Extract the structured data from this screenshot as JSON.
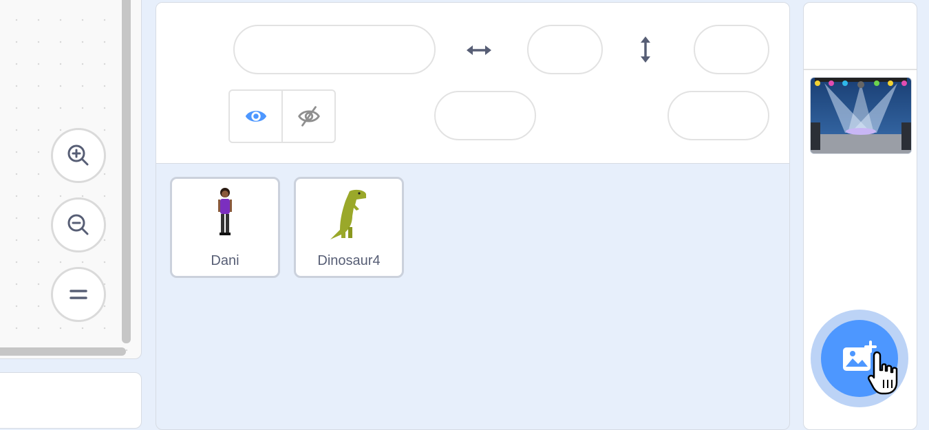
{
  "code_area": {
    "zoom_in_icon": "zoom-in-icon",
    "zoom_out_icon": "zoom-out-icon",
    "zoom_reset_icon": "equals-icon"
  },
  "sprite_info": {
    "sprite_name_value": "",
    "x_value": "",
    "y_value": "",
    "size_value": "",
    "direction_value": "",
    "x_icon": "horizontal-arrow-icon",
    "y_icon": "vertical-arrow-icon",
    "show_icon": "eye-icon",
    "hide_icon": "eye-slash-icon"
  },
  "sprites": [
    {
      "name": "Dani"
    },
    {
      "name": "Dinosaur4"
    }
  ],
  "stage": {
    "add_backdrop_icon": "add-image-icon"
  },
  "colors": {
    "accent": "#4d97ff",
    "pane_bg": "#e7effb",
    "text": "#575e75"
  }
}
